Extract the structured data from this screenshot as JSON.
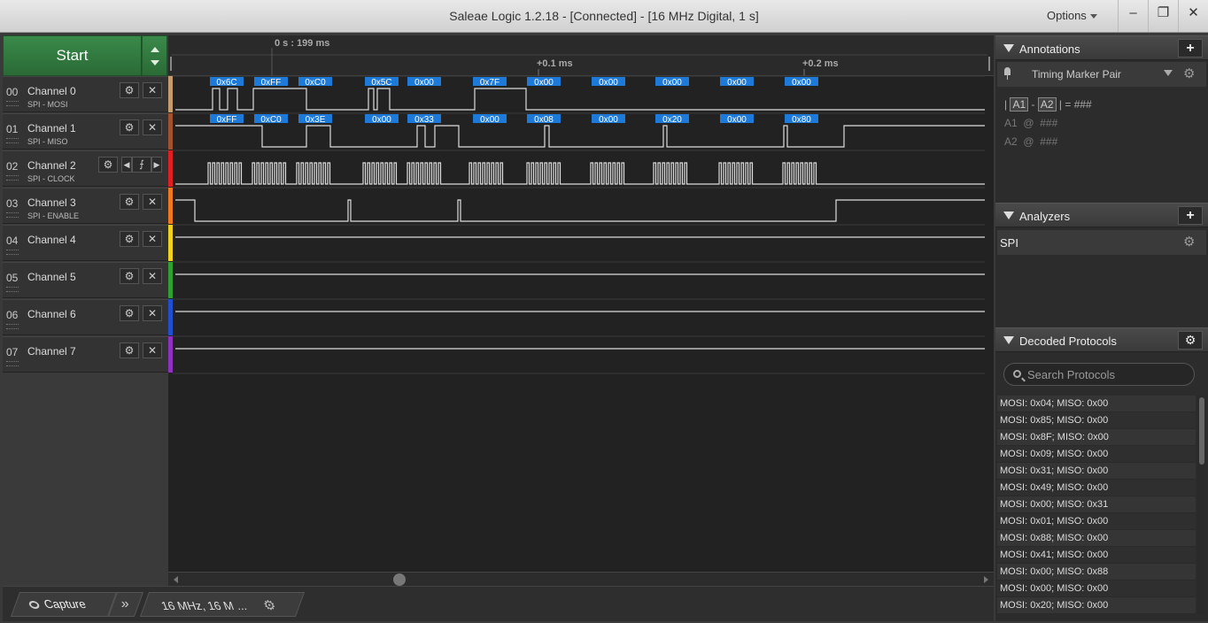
{
  "window": {
    "title": "Saleae Logic 1.2.18 - [Connected] - [16 MHz Digital, 1 s]",
    "options_label": "Options",
    "minimize": "–",
    "restore": "❐",
    "close": "✕"
  },
  "start": {
    "label": "Start"
  },
  "timeline": {
    "cursor_label": "0 s : 199 ms",
    "tick1": "+0.1 ms",
    "tick2": "+0.2 ms"
  },
  "channels": [
    {
      "num": "00",
      "name": "Channel 0",
      "sub": "SPI - MOSI",
      "color": "#c69c6d"
    },
    {
      "num": "01",
      "name": "Channel 1",
      "sub": "SPI - MISO",
      "color": "#a0522d"
    },
    {
      "num": "02",
      "name": "Channel 2",
      "sub": "SPI - CLOCK",
      "color": "#e02020"
    },
    {
      "num": "03",
      "name": "Channel 3",
      "sub": "SPI - ENABLE",
      "color": "#f07820"
    },
    {
      "num": "04",
      "name": "Channel 4",
      "sub": "",
      "color": "#f0d020"
    },
    {
      "num": "05",
      "name": "Channel 5",
      "sub": "",
      "color": "#30a030"
    },
    {
      "num": "06",
      "name": "Channel 6",
      "sub": "",
      "color": "#2050d0"
    },
    {
      "num": "07",
      "name": "Channel 7",
      "sub": "",
      "color": "#9030c0"
    }
  ],
  "mosi_labels": [
    "0x6C",
    "0xFF",
    "0xC0",
    "0x5C",
    "0x00",
    "0x7F",
    "0x00",
    "0x00",
    "0x00",
    "0x00",
    "0x00"
  ],
  "miso_labels": [
    "0xFF",
    "0xC0",
    "0x3E",
    "0x00",
    "0x33",
    "0x00",
    "0x08",
    "0x00",
    "0x20",
    "0x00",
    "0x80"
  ],
  "bottom": {
    "capture_tab": "Capture",
    "more_tab": "»",
    "rate_tab": "16 MHz, 16 M ..."
  },
  "annotations": {
    "header": "Annotations",
    "add": "+",
    "marker_name": "Timing Marker Pair",
    "pair_a1": "A1",
    "pair_a2": "A2",
    "pair_value": "###",
    "a1_label": "A1",
    "a1_value": "###",
    "a2_label": "A2",
    "a2_value": "###",
    "at": "@",
    "dash": "-",
    "bar": "|",
    "eq": "="
  },
  "analyzers": {
    "header": "Analyzers",
    "add": "+",
    "items": [
      "SPI"
    ]
  },
  "decoded": {
    "header": "Decoded Protocols",
    "search_placeholder": "Search Protocols",
    "rows": [
      "MOSI: 0x04;  MISO: 0x00",
      "MOSI: 0x85;  MISO: 0x00",
      "MOSI: 0x8F;  MISO: 0x00",
      "MOSI: 0x09;  MISO: 0x00",
      "MOSI: 0x31;  MISO: 0x00",
      "MOSI: 0x49;  MISO: 0x00",
      "MOSI: 0x00;  MISO: 0x31",
      "MOSI: 0x01;  MISO: 0x00",
      "MOSI: 0x88;  MISO: 0x00",
      "MOSI: 0x41;  MISO: 0x00",
      "MOSI: 0x00;  MISO: 0x88",
      "MOSI: 0x00;  MISO: 0x00",
      "MOSI: 0x20;  MISO: 0x00"
    ]
  }
}
